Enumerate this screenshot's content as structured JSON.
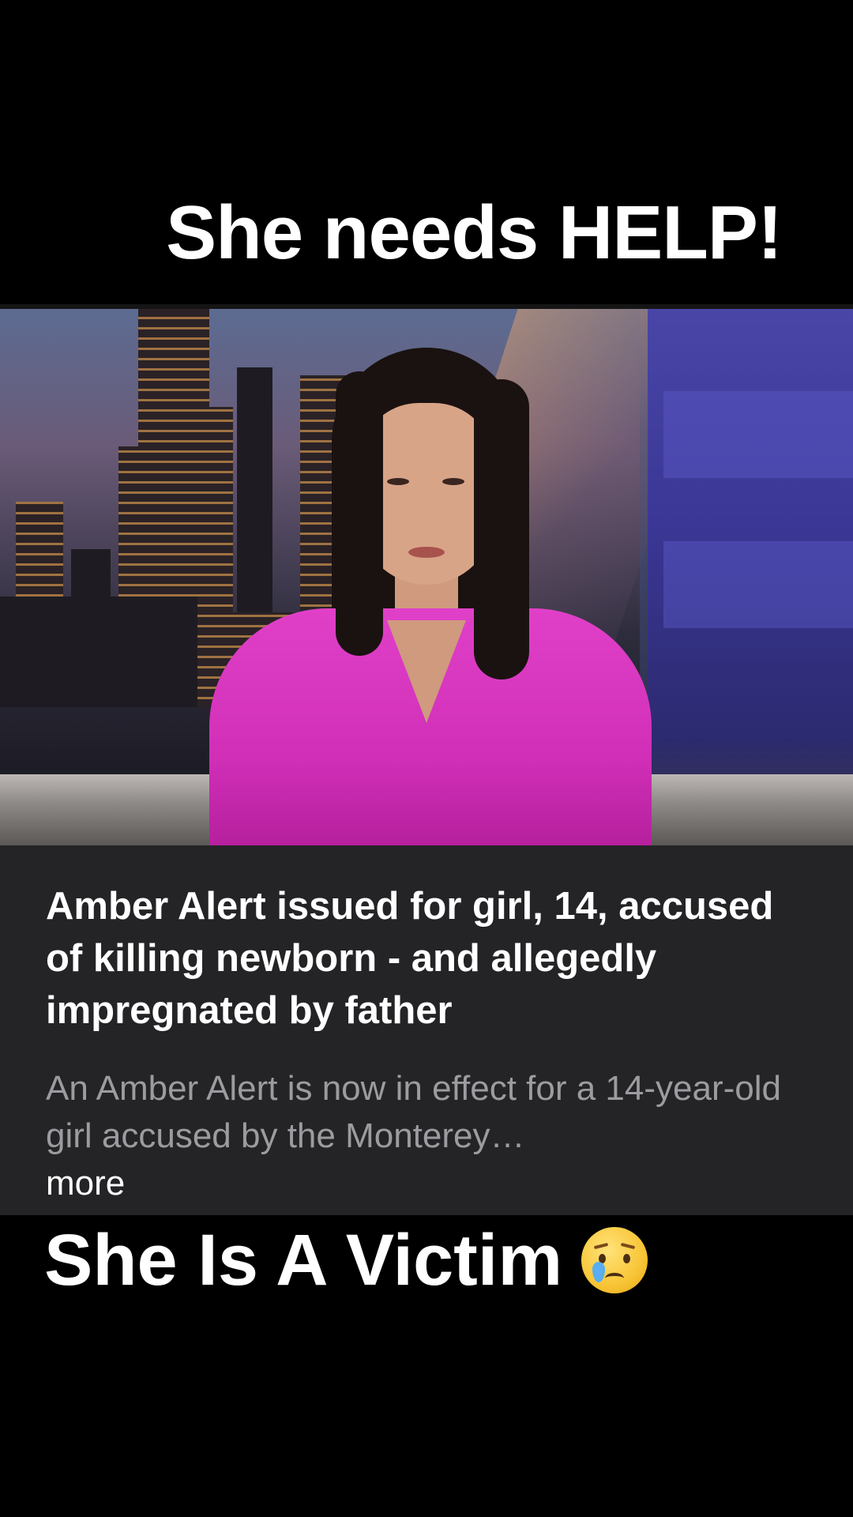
{
  "top_caption": "She needs HELP!",
  "article": {
    "headline": "Amber Alert issued for girl, 14, accused of killing newborn - and allegedly impregnated by father",
    "description": "An Amber Alert is now in effect for a 14-year-old girl accused by the Monterey…",
    "more_label": "more"
  },
  "bottom_caption": "She Is A Victim",
  "icons": {
    "caption_emoji": "crying-face-icon"
  },
  "colors": {
    "background": "#000000",
    "card_background": "#242427",
    "card_headline": "#ffffff",
    "card_description": "#9c9ca0",
    "anchor_blouse": "#d12fb8"
  }
}
